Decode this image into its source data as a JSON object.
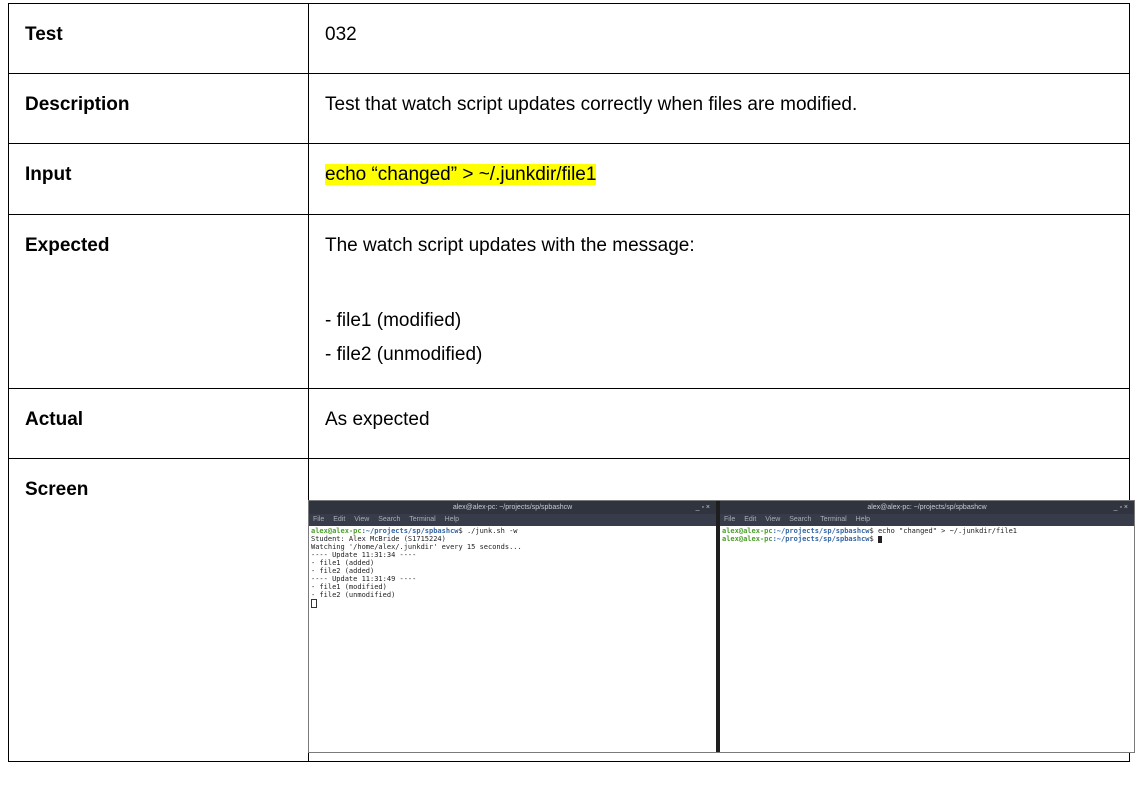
{
  "rows": {
    "test": {
      "label": "Test",
      "value": "032"
    },
    "description": {
      "label": "Description",
      "value": "Test that watch script updates correctly when files are modified."
    },
    "input": {
      "label": "Input",
      "value": "echo “changed” > ~/.junkdir/file1"
    },
    "expected": {
      "label": "Expected",
      "intro": "The watch script updates with the message:",
      "lines": [
        "- file1 (modified)",
        "- file2 (unmodified)"
      ]
    },
    "actual": {
      "label": "Actual",
      "value": "As expected"
    },
    "screen": {
      "label": "Screen"
    }
  },
  "terminals": {
    "left": {
      "title": "alex@alex-pc: ~/projects/sp/spbashcw",
      "controls": "_ ▫ ×",
      "menu": [
        "File",
        "Edit",
        "View",
        "Search",
        "Terminal",
        "Help"
      ],
      "prompt_user": "alex@alex-pc",
      "prompt_path": ":~/projects/sp/spbashcw",
      "command": "$ ./junk.sh -w",
      "output": [
        "Student: Alex McBride (S1715224)",
        "Watching '/home/alex/.junkdir' every 15 seconds...",
        "---- Update 11:31:34 ----",
        "- file1 (added)",
        "- file2 (added)",
        "---- Update 11:31:49 ----",
        "- file1 (modified)",
        "- file2 (unmodified)"
      ]
    },
    "right": {
      "title": "alex@alex-pc: ~/projects/sp/spbashcw",
      "controls": "_ ▫ ×",
      "menu": [
        "File",
        "Edit",
        "View",
        "Search",
        "Terminal",
        "Help"
      ],
      "prompt_user": "alex@alex-pc",
      "prompt_path": ":~/projects/sp/spbashcw",
      "command": "$ echo \"changed\" > ~/.junkdir/file1",
      "command2": "$ "
    }
  },
  "colors": {
    "highlight": "#ffff00",
    "terminal_bg": "#2f343f",
    "prompt_user": "#4a9e2a",
    "prompt_path": "#3465a4"
  }
}
